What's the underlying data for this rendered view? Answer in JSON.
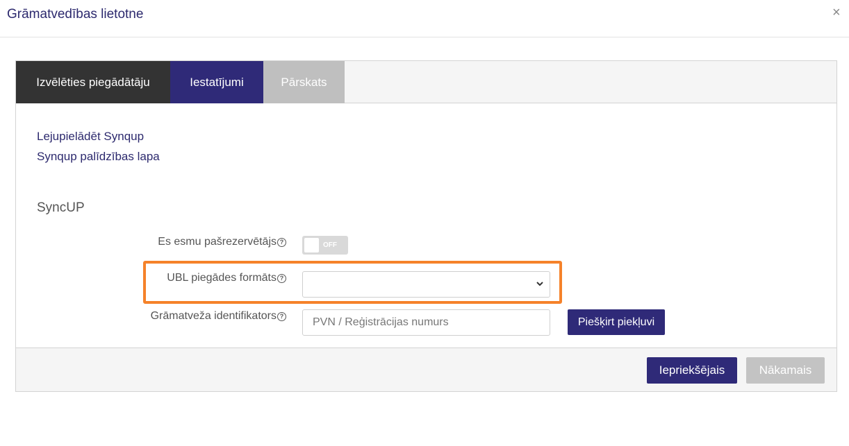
{
  "dialog": {
    "title": "Grāmatvedības lietotne",
    "close_glyph": "×"
  },
  "tabs": [
    {
      "label": "Izvēlēties piegādātāju",
      "state": "completed"
    },
    {
      "label": "Iestatījumi",
      "state": "active"
    },
    {
      "label": "Pārskats",
      "state": "disabled"
    }
  ],
  "links": [
    {
      "label": "Lejupielādēt Synqup"
    },
    {
      "label": "Synqup palīdzības lapa"
    }
  ],
  "section": {
    "title": "SyncUP"
  },
  "form": {
    "self_reserver": {
      "label": "Es esmu pašrezervētājs",
      "help_glyph": "?",
      "toggle_text": "OFF",
      "value": false
    },
    "ubl_format": {
      "label": "UBL piegādes formāts",
      "help_glyph": "?",
      "value": "",
      "highlighted": true
    },
    "accountant_id": {
      "label": "Grāmatveža identifikators",
      "help_glyph": "?",
      "value": "",
      "placeholder": "PVN / Reģistrācijas numurs",
      "button_label": "Piešķirt piekļuvi"
    }
  },
  "footer": {
    "prev_label": "Iepriekšējais",
    "next_label": "Nākamais"
  },
  "colors": {
    "brand": "#2f2a78",
    "tab_completed": "#333333",
    "disabled": "#c3c3c3",
    "highlight": "#f5822a"
  }
}
